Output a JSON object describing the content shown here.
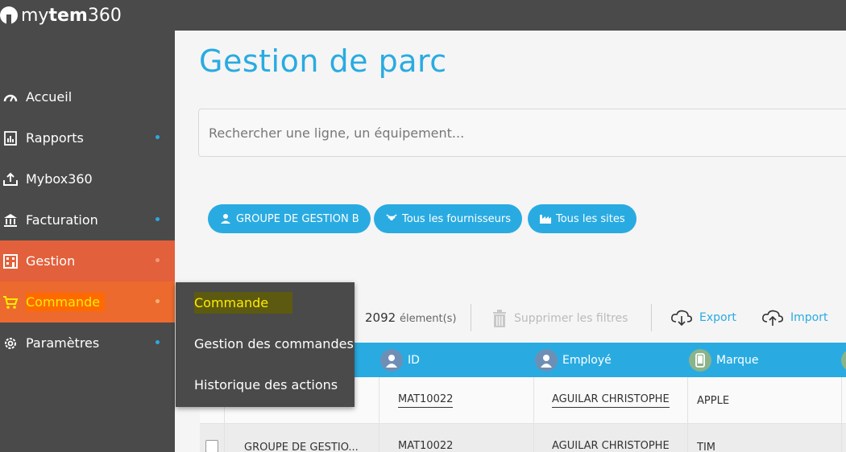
{
  "brand": {
    "light": "my",
    "bold": "tem",
    "number": "360"
  },
  "sidebar": {
    "items": [
      {
        "label": "Accueil",
        "icon": "gauge-icon",
        "has_dot": false
      },
      {
        "label": "Rapports",
        "icon": "report-icon",
        "has_dot": true
      },
      {
        "label": "Mybox360",
        "icon": "inbox-upload-icon",
        "has_dot": false
      },
      {
        "label": "Facturation",
        "icon": "bank-icon",
        "has_dot": true
      },
      {
        "label": "Gestion",
        "icon": "building-icon",
        "has_dot": true
      },
      {
        "label": "Commande",
        "icon": "cart-icon",
        "has_dot": true
      },
      {
        "label": "Paramètres",
        "icon": "gear-icon",
        "has_dot": true
      }
    ]
  },
  "dropdown": {
    "items": [
      {
        "label": "Commande",
        "active": true
      },
      {
        "label": "Gestion des commandes",
        "active": false
      },
      {
        "label": "Historique des actions",
        "active": false
      }
    ]
  },
  "main": {
    "title": "Gestion de parc",
    "search": {
      "placeholder": "Rechercher une ligne, un équipement...",
      "value": ""
    },
    "filters": [
      {
        "label": "GROUPE DE GESTION B",
        "icon": "user-group-icon"
      },
      {
        "label": "Tous les fournisseurs",
        "icon": "signal-icon"
      },
      {
        "label": "Tous les sites",
        "icon": "factory-icon"
      }
    ],
    "toolbar": {
      "count": "2092",
      "count_unit": "élement(s)",
      "clear_filters": "Supprimer les filtres",
      "export": "Export",
      "import": "Import"
    },
    "table": {
      "columns": [
        {
          "label": "ID",
          "icon": "user-avatar-icon"
        },
        {
          "label": "Employé",
          "icon": "user-avatar-icon"
        },
        {
          "label": "Marque",
          "icon": "phone-icon"
        }
      ],
      "rows": [
        {
          "group": "",
          "id": "MAT10022",
          "employee": "AGUILAR CHRISTOPHE",
          "brand": "APPLE"
        },
        {
          "group": "GROUPE DE GESTIO...",
          "id": "MAT10022",
          "employee": "AGUILAR CHRISTOPHE",
          "brand": "TIM"
        }
      ]
    }
  },
  "colors": {
    "accent": "#29abe2",
    "sidebar_bg": "#4a4a4a",
    "gestion": "#e2603b",
    "commande": "#ec6a2e",
    "highlight_text": "#ffec00"
  }
}
